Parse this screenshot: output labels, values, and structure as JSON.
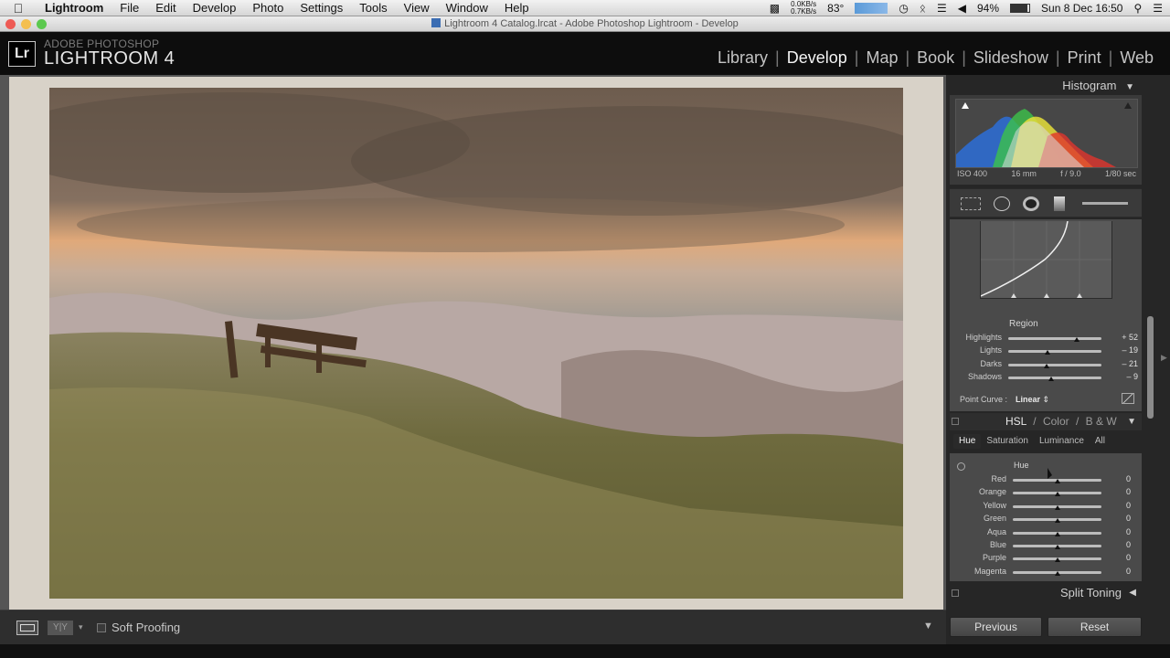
{
  "menubar": {
    "app_name": "Lightroom",
    "items": [
      "File",
      "Edit",
      "Develop",
      "Photo",
      "Settings",
      "Tools",
      "View",
      "Window",
      "Help"
    ],
    "net_up": "0.0KB/s",
    "net_down": "0.7KB/s",
    "temperature": "83°",
    "battery": "94%",
    "datetime": "Sun 8 Dec  16:50"
  },
  "window": {
    "title": "Lightroom 4 Catalog.lrcat - Adobe Photoshop Lightroom - Develop"
  },
  "identity": {
    "logo": "Lr",
    "brand_top": "ADOBE PHOTOSHOP",
    "brand_main": "LIGHTROOM 4"
  },
  "modules": [
    "Library",
    "Develop",
    "Map",
    "Book",
    "Slideshow",
    "Print",
    "Web"
  ],
  "active_module": "Develop",
  "histogram": {
    "title": "Histogram",
    "iso": "ISO 400",
    "focal": "16 mm",
    "aperture": "f / 9.0",
    "shutter": "1/80 sec"
  },
  "tone_curve": {
    "region_label": "Region",
    "sliders": [
      {
        "label": "Highlights",
        "value": "+ 52",
        "level": 0.74
      },
      {
        "label": "Lights",
        "value": "– 19",
        "level": 0.42
      },
      {
        "label": "Darks",
        "value": "– 21",
        "level": 0.41
      },
      {
        "label": "Shadows",
        "value": "– 9",
        "level": 0.46
      }
    ],
    "point_curve_label": "Point Curve :",
    "point_curve_value": "Linear"
  },
  "hsl": {
    "header_hsl": "HSL",
    "header_sep": "/",
    "header_color": "Color",
    "header_bw": "B & W",
    "tabs": [
      "Hue",
      "Saturation",
      "Luminance",
      "All"
    ],
    "active_tab": "Hue",
    "section_title": "Hue",
    "sliders": [
      {
        "label": "Red",
        "value": "0"
      },
      {
        "label": "Orange",
        "value": "0"
      },
      {
        "label": "Yellow",
        "value": "0"
      },
      {
        "label": "Green",
        "value": "0"
      },
      {
        "label": "Aqua",
        "value": "0"
      },
      {
        "label": "Blue",
        "value": "0"
      },
      {
        "label": "Purple",
        "value": "0"
      },
      {
        "label": "Magenta",
        "value": "0"
      }
    ]
  },
  "split_toning": {
    "title": "Split Toning"
  },
  "toolbar": {
    "soft_proofing": "Soft Proofing"
  },
  "buttons": {
    "previous": "Previous",
    "reset": "Reset"
  },
  "colors": {
    "panel_bg": "#3a3a3a",
    "identity_bg": "#0d0d0d",
    "canvas_bg": "#555555"
  }
}
